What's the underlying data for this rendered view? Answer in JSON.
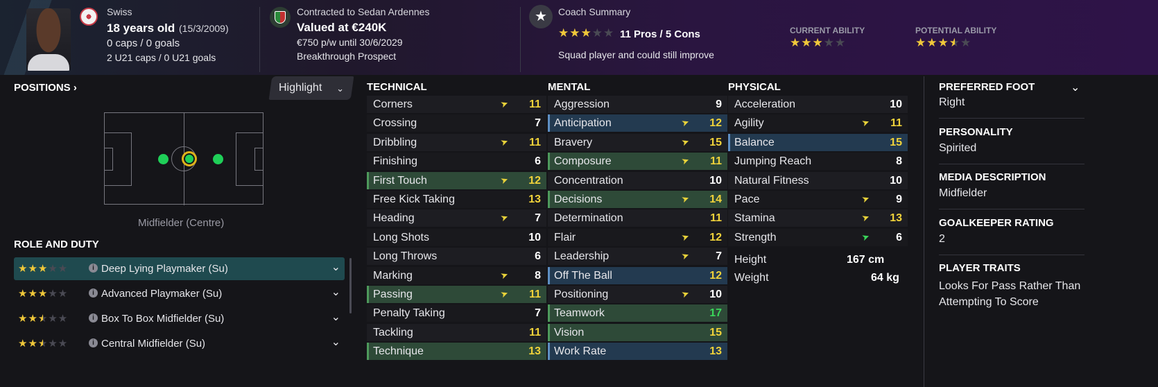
{
  "player": {
    "nationality": "Swiss",
    "age_text": "18 years old",
    "dob": "(15/3/2009)",
    "caps": "0 caps / 0 goals",
    "u21": "2 U21 caps / 0 U21 goals"
  },
  "contract": {
    "club_line": "Contracted to Sedan Ardennes",
    "value": "Valued at €240K",
    "wage": "€750 p/w until 30/6/2029",
    "status": "Breakthrough Prospect"
  },
  "coach": {
    "title": "Coach Summary",
    "pros_cons": "11 Pros / 5 Cons",
    "summary": "Squad player and could still improve",
    "current_ability_label": "CURRENT ABILITY",
    "potential_ability_label": "POTENTIAL ABILITY"
  },
  "positions": {
    "title": "POSITIONS",
    "highlight_label": "Highlight",
    "position_name": "Midfielder (Centre)"
  },
  "roles": {
    "title": "ROLE AND DUTY",
    "items": [
      {
        "label": "Deep Lying Playmaker (Su)",
        "stars": 3
      },
      {
        "label": "Advanced Playmaker (Su)",
        "stars": 3
      },
      {
        "label": "Box To Box Midfielder (Su)",
        "stars": 2.5
      },
      {
        "label": "Central Midfielder (Su)",
        "stars": 2.5
      }
    ]
  },
  "technical": {
    "title": "TECHNICAL",
    "items": [
      {
        "name": "Corners",
        "value": "11"
      },
      {
        "name": "Crossing",
        "value": "7"
      },
      {
        "name": "Dribbling",
        "value": "11"
      },
      {
        "name": "Finishing",
        "value": "6"
      },
      {
        "name": "First Touch",
        "value": "12"
      },
      {
        "name": "Free Kick Taking",
        "value": "13"
      },
      {
        "name": "Heading",
        "value": "7"
      },
      {
        "name": "Long Shots",
        "value": "10"
      },
      {
        "name": "Long Throws",
        "value": "6"
      },
      {
        "name": "Marking",
        "value": "8"
      },
      {
        "name": "Passing",
        "value": "11"
      },
      {
        "name": "Penalty Taking",
        "value": "7"
      },
      {
        "name": "Tackling",
        "value": "11"
      },
      {
        "name": "Technique",
        "value": "13"
      }
    ]
  },
  "mental": {
    "title": "MENTAL",
    "items": [
      {
        "name": "Aggression",
        "value": "9"
      },
      {
        "name": "Anticipation",
        "value": "12"
      },
      {
        "name": "Bravery",
        "value": "15"
      },
      {
        "name": "Composure",
        "value": "11"
      },
      {
        "name": "Concentration",
        "value": "10"
      },
      {
        "name": "Decisions",
        "value": "14"
      },
      {
        "name": "Determination",
        "value": "11"
      },
      {
        "name": "Flair",
        "value": "12"
      },
      {
        "name": "Leadership",
        "value": "7"
      },
      {
        "name": "Off The Ball",
        "value": "12"
      },
      {
        "name": "Positioning",
        "value": "10"
      },
      {
        "name": "Teamwork",
        "value": "17"
      },
      {
        "name": "Vision",
        "value": "15"
      },
      {
        "name": "Work Rate",
        "value": "13"
      }
    ]
  },
  "physical": {
    "title": "PHYSICAL",
    "items": [
      {
        "name": "Acceleration",
        "value": "10"
      },
      {
        "name": "Agility",
        "value": "11"
      },
      {
        "name": "Balance",
        "value": "15"
      },
      {
        "name": "Jumping Reach",
        "value": "8"
      },
      {
        "name": "Natural Fitness",
        "value": "10"
      },
      {
        "name": "Pace",
        "value": "9"
      },
      {
        "name": "Stamina",
        "value": "13"
      },
      {
        "name": "Strength",
        "value": "6"
      }
    ],
    "height_label": "Height",
    "height_value": "167 cm",
    "weight_label": "Weight",
    "weight_value": "64 kg"
  },
  "info": {
    "foot_label": "PREFERRED FOOT",
    "foot_value": "Right",
    "personality_label": "PERSONALITY",
    "personality_value": "Spirited",
    "media_label": "MEDIA DESCRIPTION",
    "media_value": "Midfielder",
    "gk_label": "GOALKEEPER RATING",
    "gk_value": "2",
    "traits_label": "PLAYER TRAITS",
    "traits_line1": "Looks For Pass Rather Than",
    "traits_line2": "Attempting To Score"
  },
  "colors": {
    "accent_yellow": "#f0d23a",
    "accent_green": "#3ad65a",
    "star_gold": "#f0c83a"
  }
}
